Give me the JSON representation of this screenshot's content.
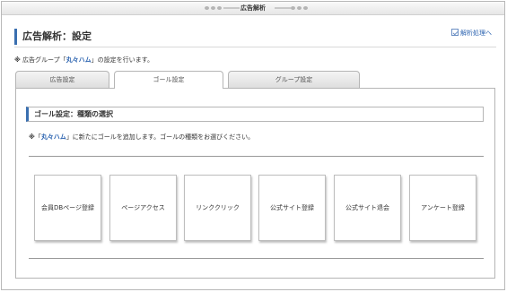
{
  "window": {
    "title": "広告解析"
  },
  "header": {
    "title": "広告解析：設定",
    "back_link": "解析処理へ"
  },
  "info": {
    "prefix": "広告グループ「",
    "group_name": "丸々ハム",
    "suffix": "」の設定を行います。"
  },
  "tabs": [
    {
      "label": "広告設定",
      "active": false
    },
    {
      "label": "ゴール設定",
      "active": true
    },
    {
      "label": "グループ設定",
      "active": false
    }
  ],
  "section": {
    "title": "ゴール設定：種類の選択",
    "note_mark": "※",
    "note_prefix": "「",
    "note_name": "丸々ハム",
    "note_suffix": "」に新たにゴールを追加します。ゴールの種類をお選びください。"
  },
  "goal_types": [
    "会員DBページ登録",
    "ページアクセス",
    "リンククリック",
    "公式サイト登録",
    "公式サイト退会",
    "アンケート登録"
  ],
  "colors": {
    "accent": "#3a6fb0",
    "link": "#2b63b0"
  }
}
